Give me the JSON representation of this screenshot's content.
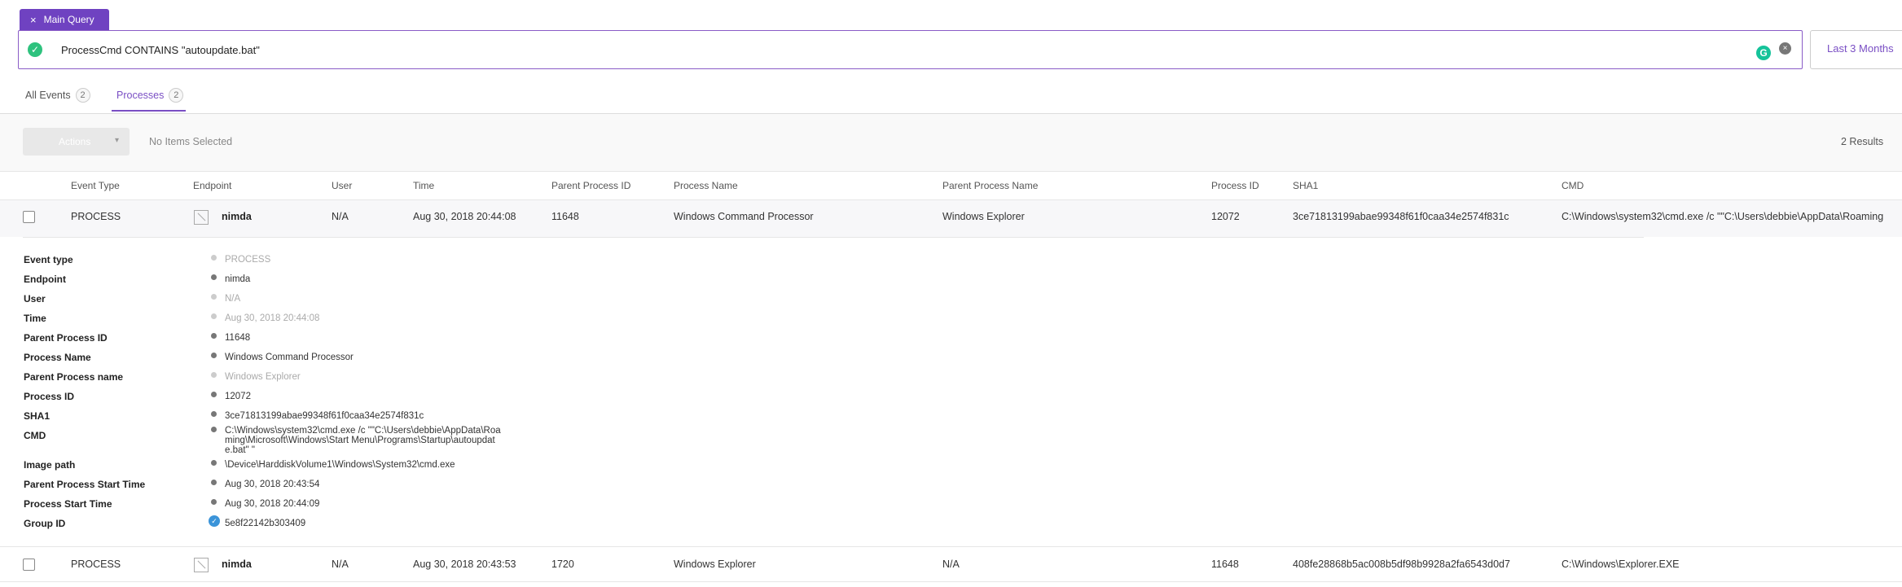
{
  "query_tab": {
    "close_glyph": "×",
    "label": "Main Query"
  },
  "query": {
    "text": "ProcessCmd CONTAINS \"autoupdate.bat\"",
    "ok_glyph": "✓",
    "g_glyph": "G",
    "clear_glyph": "×"
  },
  "time_range": {
    "label": "Last 3 Months"
  },
  "tabs": [
    {
      "label": "All Events",
      "count": "2"
    },
    {
      "label": "Processes",
      "count": "2"
    }
  ],
  "toolbar": {
    "actions_label": "Actions",
    "selection_text": "No Items Selected",
    "results_text": "2 Results"
  },
  "columns": [
    "Event Type",
    "Endpoint",
    "User",
    "Time",
    "Parent Process ID",
    "Process Name",
    "Parent Process Name",
    "Process ID",
    "SHA1",
    "CMD"
  ],
  "rows": [
    {
      "event_type": "PROCESS",
      "endpoint": "nimda",
      "user": "N/A",
      "time": "Aug 30, 2018 20:44:08",
      "parent_pid": "11648",
      "process_name": "Windows Command Processor",
      "parent_process_name": "Windows Explorer",
      "pid": "12072",
      "sha1": "3ce71813199abae99348f61f0caa34e2574f831c",
      "cmd": "C:\\Windows\\system32\\cmd.exe /c \"\"C:\\Users\\debbie\\AppData\\Roaming"
    },
    {
      "event_type": "PROCESS",
      "endpoint": "nimda",
      "user": "N/A",
      "time": "Aug 30, 2018 20:43:53",
      "parent_pid": "1720",
      "process_name": "Windows Explorer",
      "parent_process_name": "N/A",
      "pid": "11648",
      "sha1": "408fe28868b5ac008b5df98b9928a2fa6543d0d7",
      "cmd": "C:\\Windows\\Explorer.EXE"
    }
  ],
  "details": {
    "labels": {
      "event_type": "Event type",
      "endpoint": "Endpoint",
      "user": "User",
      "time": "Time",
      "parent_pid": "Parent Process ID",
      "process_name": "Process Name",
      "parent_process_name": "Parent Process name",
      "pid": "Process ID",
      "sha1": "SHA1",
      "cmd": "CMD",
      "image_path": "Image path",
      "parent_start": "Parent Process Start Time",
      "start": "Process Start Time",
      "group_id": "Group ID"
    },
    "values": {
      "event_type": "PROCESS",
      "endpoint": "nimda",
      "user": "N/A",
      "time": "Aug 30, 2018 20:44:08",
      "parent_pid": "11648",
      "process_name": "Windows Command Processor",
      "parent_process_name": "Windows Explorer",
      "pid": "12072",
      "sha1": "3ce71813199abae99348f61f0caa34e2574f831c",
      "cmd": "C:\\Windows\\system32\\cmd.exe /c \"\"C:\\Users\\debbie\\AppData\\Roaming\\Microsoft\\Windows\\Start Menu\\Programs\\Startup\\autoupdate.bat\" \"",
      "image_path": "\\Device\\HarddiskVolume1\\Windows\\System32\\cmd.exe",
      "parent_start": "Aug 30, 2018 20:43:54",
      "start": "Aug 30, 2018 20:44:09",
      "group_id": "5e8f22142b303409",
      "group_glyph": "✓"
    }
  }
}
